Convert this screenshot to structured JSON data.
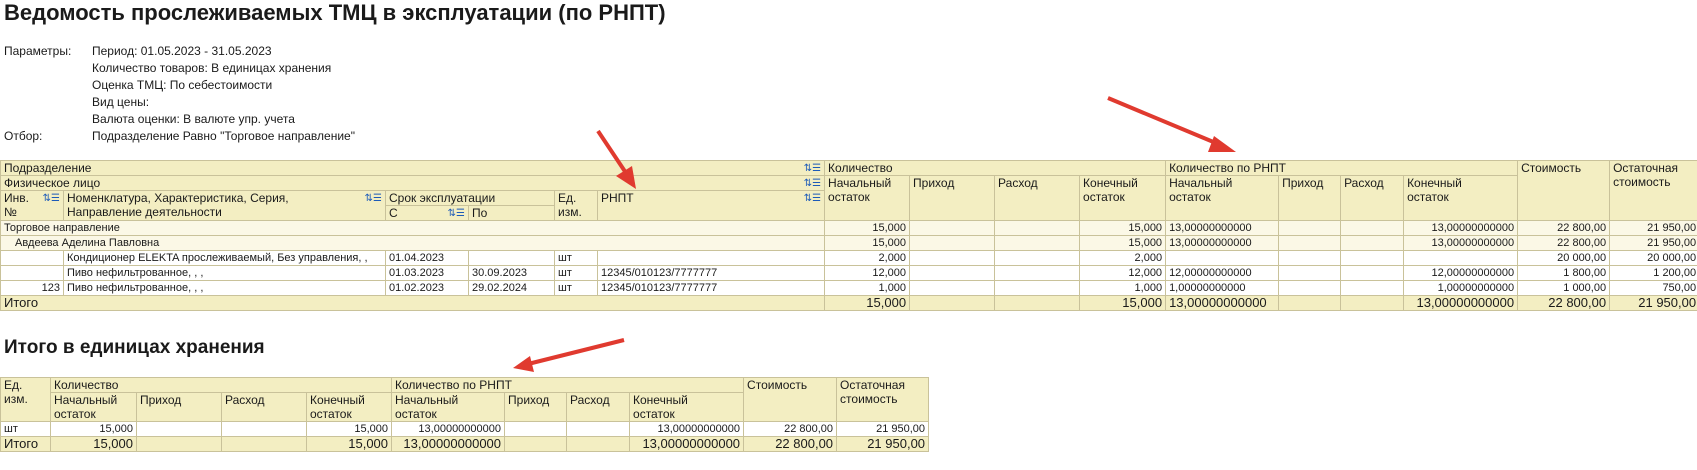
{
  "report": {
    "title": "Ведомость прослеживаемых ТМЦ в эксплуатации (по РНПТ)",
    "params": [
      {
        "label": "Параметры:",
        "value": "Период: 01.05.2023 - 31.05.2023"
      },
      {
        "label": "",
        "value": "Количество товаров: В единицах хранения"
      },
      {
        "label": "",
        "value": "Оценка ТМЦ: По себестоимости"
      },
      {
        "label": "",
        "value": "Вид цены:"
      },
      {
        "label": "",
        "value": "Валюта оценки: В валюте упр. учета"
      },
      {
        "label": "Отбор:",
        "value": "Подразделение Равно \"Торговое направление\""
      }
    ],
    "header": {
      "podrazd": "Подразделение",
      "fizlico": "Физическое лицо",
      "inv1": "Инв.",
      "inv2": "№",
      "nom1": "Номенклатура, Характеристика, Серия,",
      "nom2": "Направление деятельности",
      "srok": "Срок эксплуатации",
      "srok_s": "С",
      "srok_po": "По",
      "ed1": "Ед.",
      "ed2": "изм.",
      "rnpt": "РНПТ",
      "kol": "Количество",
      "kolr": "Количество по РНПТ",
      "nach1": "Начальный",
      "nach2": "остаток",
      "prihod": "Приход",
      "rashod": "Расход",
      "kon1": "Конечный",
      "kon2": "остаток",
      "stoim": "Стоимость",
      "ost1": "Остаточная",
      "ost2": "стоимость"
    },
    "group_row": {
      "name": "Торговое направление",
      "kol_nach": "15,000",
      "kol_kon": "15,000",
      "r_nach": "13,00000000000",
      "r_kon": "13,00000000000",
      "stoim": "22 800,00",
      "ost": "21 950,00"
    },
    "person_row": {
      "name": "Авдеева Аделина Павловна",
      "kol_nach": "15,000",
      "kol_kon": "15,000",
      "r_nach": "13,00000000000",
      "r_kon": "13,00000000000",
      "stoim": "22 800,00",
      "ost": "21 950,00"
    },
    "items": [
      {
        "inv": "",
        "nom": "Кондиционер ELEKTA прослеживаемый, Без управления, ,",
        "s": "01.04.2023",
        "po": "",
        "ed": "шт",
        "rnpt": "",
        "kol_nach": "2,000",
        "kol_kon": "2,000",
        "r_nach": "",
        "r_kon": "",
        "stoim": "20 000,00",
        "ost": "20 000,00"
      },
      {
        "inv": "",
        "nom": "Пиво нефильтрованное, , ,",
        "s": "01.03.2023",
        "po": "30.09.2023",
        "ed": "шт",
        "rnpt": "12345/010123/7777777",
        "kol_nach": "12,000",
        "kol_kon": "12,000",
        "r_nach": "12,00000000000",
        "r_kon": "12,00000000000",
        "stoim": "1 800,00",
        "ost": "1 200,00"
      },
      {
        "inv": "123",
        "nom": "Пиво нефильтрованное, , ,",
        "s": "01.02.2023",
        "po": "29.02.2024",
        "ed": "шт",
        "rnpt": "12345/010123/7777777",
        "kol_nach": "1,000",
        "kol_kon": "1,000",
        "r_nach": "1,00000000000",
        "r_kon": "1,00000000000",
        "stoim": "1 000,00",
        "ost": "750,00"
      }
    ],
    "total": {
      "label": "Итого",
      "kol_nach": "15,000",
      "kol_kon": "15,000",
      "r_nach": "13,00000000000",
      "r_kon": "13,00000000000",
      "stoim": "22 800,00",
      "ost": "21 950,00"
    }
  },
  "summary": {
    "title": "Итого в единицах хранения",
    "header": {
      "ed1": "Ед.",
      "ed2": "изм.",
      "kol": "Количество",
      "kolr": "Количество по РНПТ",
      "nach1": "Начальный",
      "nach2": "остаток",
      "prihod": "Приход",
      "rashod": "Расход",
      "kon1": "Конечный",
      "kon2": "остаток",
      "stoim": "Стоимость",
      "ost1": "Остаточная",
      "ost2": "стоимость"
    },
    "row": {
      "ed": "шт",
      "kol_nach": "15,000",
      "kol_kon": "15,000",
      "r_nach": "13,00000000000",
      "r_kon": "13,00000000000",
      "stoim": "22 800,00",
      "ost": "21 950,00"
    },
    "total": {
      "label": "Итого",
      "kol_nach": "15,000",
      "kol_kon": "15,000",
      "r_nach": "13,00000000000",
      "r_kon": "13,00000000000",
      "stoim": "22 800,00",
      "ost": "21 950,00"
    }
  },
  "colors": {
    "header_bg": "#f3eec2",
    "arrow": "#e03a2f",
    "sort_icon": "#1d5bb8"
  },
  "icons": {
    "sort": "sort-order-icon",
    "arrow": "red-annotation-arrow-icon"
  }
}
